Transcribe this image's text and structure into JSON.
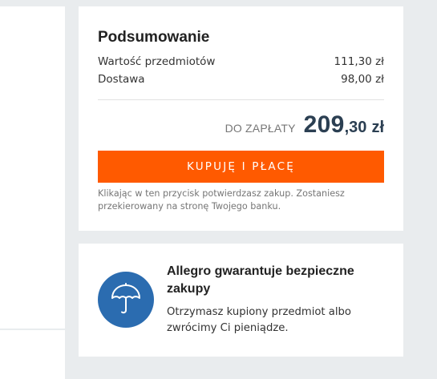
{
  "summary": {
    "title": "Podsumowanie",
    "items_label": "Wartość przedmiotów",
    "items_value": "111,30 zł",
    "delivery_label": "Dostawa",
    "delivery_value": "98,00 zł",
    "total_label": "DO ZAPŁATY",
    "total_int": "209",
    "total_dec": ",30",
    "total_currency": "zł",
    "pay_button_label": "KUPUJĘ I PŁACĘ",
    "disclaimer": "Klikając w ten przycisk potwierdzasz zakup. Zostaniesz przekierowany na stronę Twojego banku."
  },
  "guarantee": {
    "title": "Allegro gwarantuje bezpieczne zakupy",
    "text": "Otrzymasz kupiony przedmiot albo zwrócimy Ci pieniądze.",
    "icon": "umbrella-icon"
  },
  "colors": {
    "accent": "#ff5a00",
    "icon_bg": "#2b6cb0",
    "total_text": "#2b3f52",
    "page_bg": "#e9ecee"
  }
}
